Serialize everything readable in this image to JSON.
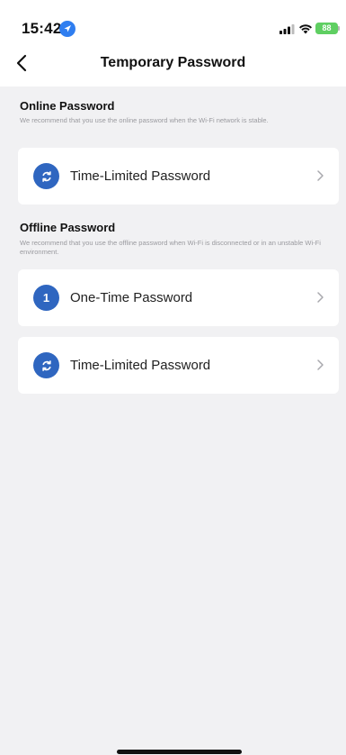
{
  "status_bar": {
    "time": "15:42",
    "battery": "88"
  },
  "nav": {
    "title": "Temporary Password"
  },
  "sections": [
    {
      "title": "Online Password",
      "description": "We recommend that you use the online password when the Wi-Fi network is stable.",
      "items": [
        {
          "label": "Time-Limited Password",
          "icon": "refresh-icon"
        }
      ]
    },
    {
      "title": "Offline Password",
      "description": "We recommend that you use the offline password when Wi-Fi is disconnected or in an unstable Wi-Fi environment.",
      "items": [
        {
          "label": "One-Time Password",
          "icon": "number-one-icon",
          "icon_text": "1"
        },
        {
          "label": "Time-Limited Password",
          "icon": "refresh-icon"
        }
      ]
    }
  ],
  "colors": {
    "accent": "#2f66c0",
    "background": "#f1f1f3",
    "card": "#ffffff",
    "battery": "#5fcf62"
  }
}
